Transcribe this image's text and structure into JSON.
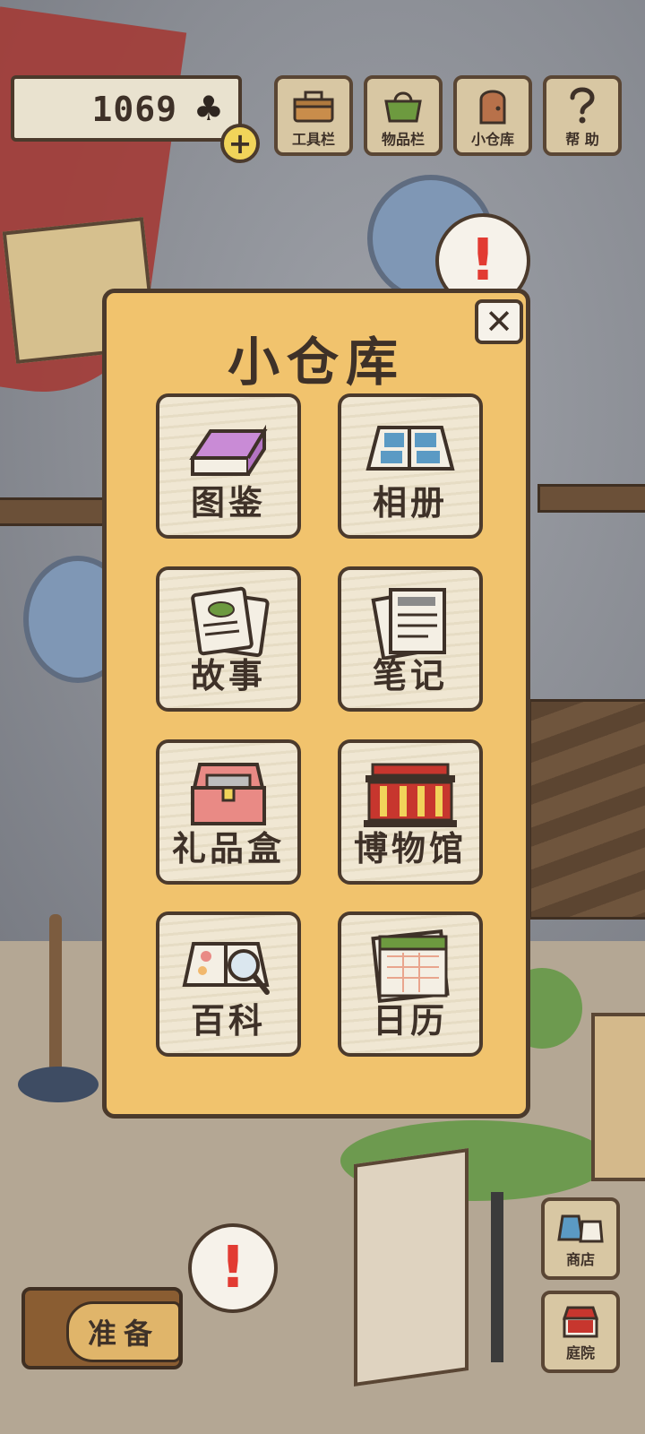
{
  "hud": {
    "clover_count": "1069",
    "clover_icon": "♣",
    "plus_icon": "+",
    "buttons": [
      {
        "id": "tools",
        "label": "工具栏",
        "icon": "toolbox-icon"
      },
      {
        "id": "items",
        "label": "物品栏",
        "icon": "bag-icon"
      },
      {
        "id": "storage",
        "label": "小仓库",
        "icon": "door-icon"
      },
      {
        "id": "help",
        "label": "帮 助",
        "icon": "question-icon"
      }
    ]
  },
  "bubbles": {
    "top_mark": "!",
    "bottom_mark": "!"
  },
  "modal": {
    "title": "小仓库",
    "close_icon": "✕",
    "tiles": [
      {
        "label": "图鉴",
        "icon": "book-icon"
      },
      {
        "label": "相册",
        "icon": "photo-album-icon"
      },
      {
        "label": "故事",
        "icon": "story-cards-icon"
      },
      {
        "label": "笔记",
        "icon": "notes-icon"
      },
      {
        "label": "礼品盒",
        "icon": "gift-box-icon"
      },
      {
        "label": "博物馆",
        "icon": "museum-icon"
      },
      {
        "label": "百科",
        "icon": "encyclopedia-icon"
      },
      {
        "label": "日历",
        "icon": "calendar-icon"
      }
    ]
  },
  "bottom": {
    "prepare_label": "准备",
    "shop_label": "商店",
    "yard_label": "庭院"
  },
  "colors": {
    "panel": "#f1c36d",
    "tile": "#f0e7d3",
    "outline": "#4b3a2c",
    "alert_red": "#e23b32",
    "accent_yellow": "#f1d45a"
  }
}
